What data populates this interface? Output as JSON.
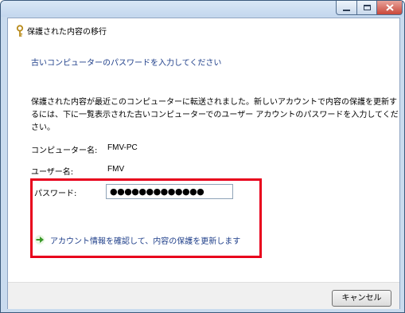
{
  "window": {
    "title": "保護された内容の移行",
    "controls": {
      "minimize": "minimize-icon",
      "maximize": "maximize-icon",
      "close": "close-icon"
    }
  },
  "main": {
    "heading": "古いコンピューターのパスワードを入力してください",
    "description_lines": [
      "保護された内容が最近このコンピューターに転送されました。新しいアカウントで内容の保護を更新す",
      "るには、下に一覧表示された古いコンピューターでのユーザー アカウントのパスワードを入力してくだ",
      "さい。"
    ],
    "computer_name_label": "コンピューター名:",
    "computer_name_value": "FMV-PC",
    "user_name_label": "ユーザー名:",
    "user_name_value": "FMV",
    "password_label": "パスワード:",
    "password_value": "●●●●●●●●●●●●●",
    "action_link": "アカウント情報を確認して、内容の保護を更新します"
  },
  "footer": {
    "cancel_label": "キャンセル"
  },
  "colors": {
    "heading": "#1f3f8a",
    "highlight": "#e8001c",
    "arrow": "#3a9a2a"
  }
}
